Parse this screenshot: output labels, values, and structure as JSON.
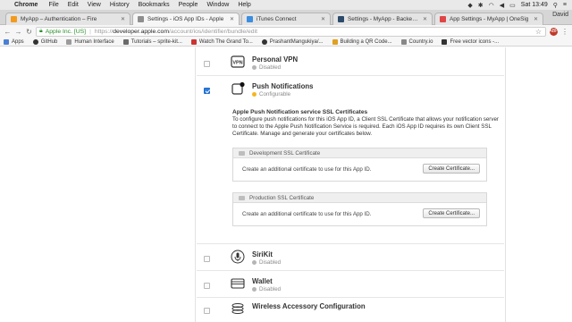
{
  "menubar": {
    "app": "Chrome",
    "items": [
      "File",
      "Edit",
      "View",
      "History",
      "Bookmarks",
      "People",
      "Window",
      "Help"
    ],
    "clock": "Sat 13:49",
    "user": "David"
  },
  "tabs": [
    {
      "label": "MyApp – Authentication – Fire",
      "color": "#f29b1d"
    },
    {
      "label": "Settings - iOS App IDs - Apple",
      "color": "#8e8e8e"
    },
    {
      "label": "iTunes Connect",
      "color": "#3b8ee0"
    },
    {
      "label": "Settings - MyApp - Backendless",
      "color": "#2c4a6b"
    },
    {
      "label": "App Settings - MyApp | OneSig",
      "color": "#e04545"
    }
  ],
  "address": {
    "secure_label": "Apple Inc. [US]",
    "scheme": "https://",
    "host": "developer.apple.com",
    "path": "/account/ios/identifier/bundle/edit",
    "ext_label": "ABP"
  },
  "bookmarks": [
    {
      "label": "Apps",
      "color": "#4a7fd6"
    },
    {
      "label": "GitHub",
      "color": "#333333"
    },
    {
      "label": "Human Interface",
      "color": "#9b9b9b"
    },
    {
      "label": "Tutorials – sprite-kit...",
      "color": "#6b6b6b"
    },
    {
      "label": "Watch The Grand To...",
      "color": "#cc3333"
    },
    {
      "label": "PrashantMangukiya/...",
      "color": "#333333"
    },
    {
      "label": "Building a QR Code...",
      "color": "#e0a020"
    },
    {
      "label": "Country.io",
      "color": "#888888"
    },
    {
      "label": "Free vector icons -...",
      "color": "#333333"
    }
  ],
  "services": {
    "vpn": {
      "name": "Personal VPN",
      "status": "Disabled",
      "icon": "vpn-icon",
      "checked": false
    },
    "push": {
      "name": "Push Notifications",
      "status": "Configurable",
      "icon": "push-notifications-icon",
      "checked": true
    },
    "siri": {
      "name": "SiriKit",
      "status": "Disabled",
      "icon": "microphone-icon",
      "checked": false
    },
    "wallet": {
      "name": "Wallet",
      "status": "Disabled",
      "icon": "wallet-icon",
      "checked": false
    },
    "wireless": {
      "name": "Wireless Accessory Configuration",
      "status": "",
      "icon": "wireless-accessory-icon",
      "checked": false
    }
  },
  "push_ssl": {
    "title": "Apple Push Notification service SSL Certificates",
    "description": "To configure push notifications for this iOS App ID, a Client SSL Certificate that allows your notification server to connect to the Apple Push Notification Service is required. Each iOS App ID requires its own Client SSL Certificate. Manage and generate your certificates below.",
    "development": {
      "header": "Development SSL Certificate",
      "text": "Create an additional certificate to use for this App ID.",
      "button": "Create Certificate..."
    },
    "production": {
      "header": "Production SSL Certificate",
      "text": "Create an additional certificate to use for this App ID.",
      "button": "Create Certificate..."
    }
  }
}
